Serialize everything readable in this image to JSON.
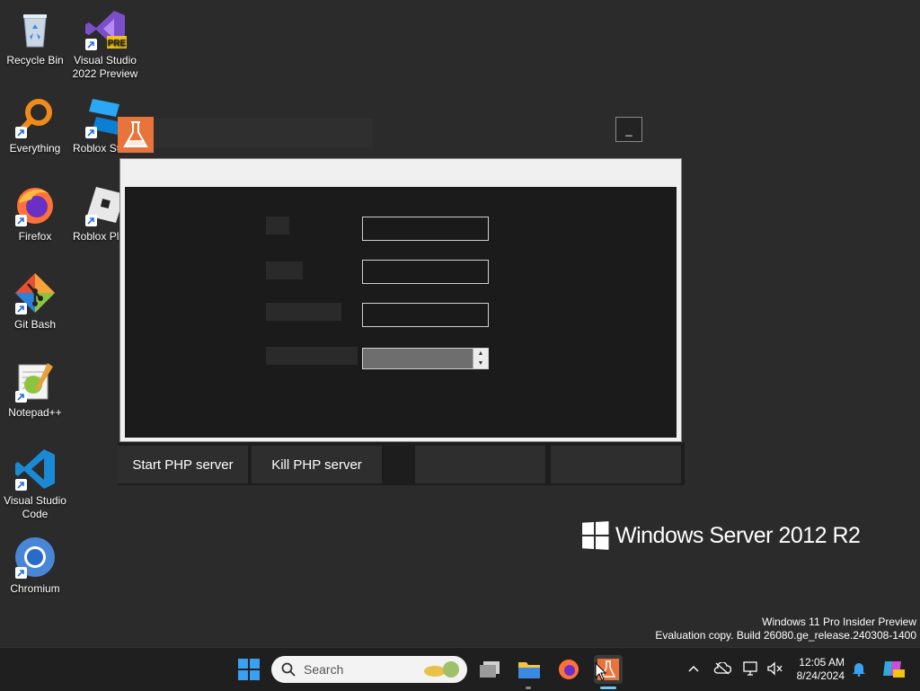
{
  "desktop": {
    "icons": [
      {
        "label": "Recycle Bin",
        "icon": "recycle-bin-icon"
      },
      {
        "label": "Visual Studio 2022 Preview",
        "icon": "visual-studio-icon",
        "badge": "PRE"
      },
      {
        "label": "Everything",
        "icon": "everything-search-icon"
      },
      {
        "label": "Roblox St",
        "icon": "roblox-studio-icon"
      },
      {
        "label": "Firefox",
        "icon": "firefox-icon"
      },
      {
        "label": "Roblox Pl",
        "icon": "roblox-player-icon"
      },
      {
        "label": "Git Bash",
        "icon": "git-bash-icon"
      },
      {
        "label": "Notepad++",
        "icon": "notepad-plus-plus-icon"
      },
      {
        "label": "Visual Studio Code",
        "icon": "vscode-icon"
      },
      {
        "label": "Chromium",
        "icon": "chromium-icon"
      }
    ]
  },
  "app": {
    "minimize_label": "_",
    "buttons": {
      "start": "Start PHP server",
      "kill": "Kill PHP server"
    }
  },
  "branding": {
    "server": "Windows Server 2012 R2"
  },
  "watermark": {
    "line1": "Windows 11 Pro Insider Preview",
    "line2": "Evaluation copy. Build 26080.ge_release.240308-1400"
  },
  "taskbar": {
    "search_placeholder": "Search",
    "time": "12:05 AM",
    "date": "8/24/2024"
  },
  "colors": {
    "accent": "#60cdff",
    "app_icon": "#e8743b",
    "desktop_bg": "#2b2b2b"
  }
}
